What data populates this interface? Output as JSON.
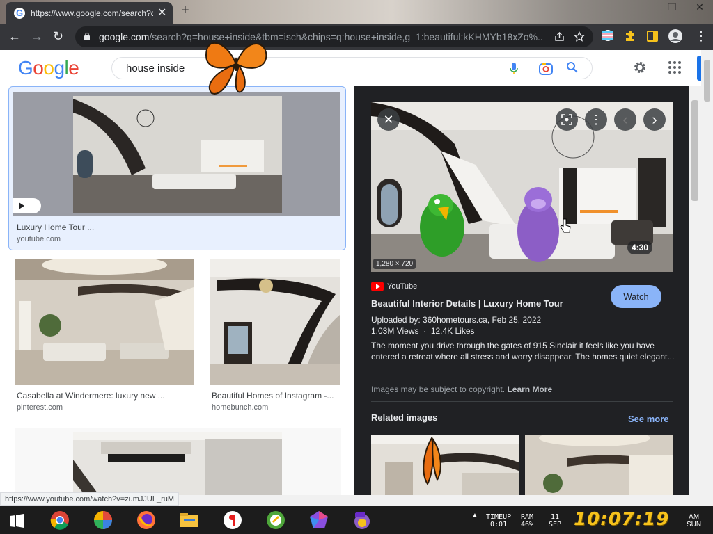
{
  "browser": {
    "tab_title": "https://www.google.com/search?q=house+inside",
    "tab_close": "✕",
    "new_tab": "+",
    "win_min": "—",
    "win_max": "❐",
    "win_close": "✕",
    "url_domain": "google.com",
    "url_rest": "/search?q=house+inside&tbm=isch&chips=q:house+inside,g_1:beautiful:kKHMYb18xZo%...",
    "back": "←",
    "forward": "→",
    "reload": "↻",
    "menu": "⋮",
    "status_url": "https://www.youtube.com/watch?v=zumJJUL_ruM"
  },
  "google": {
    "logo_letters": [
      "G",
      "o",
      "o",
      "g",
      "l",
      "e"
    ],
    "logo_colors": [
      "#4285f4",
      "#ea4335",
      "#fbbc05",
      "#4285f4",
      "#34a853",
      "#ea4335"
    ],
    "query": "house inside"
  },
  "results": [
    {
      "title": "Luxury Home Tour ...",
      "source": "youtube.com"
    },
    {
      "title": "Casabella at Windermere: luxury new ...",
      "source": "pinterest.com"
    },
    {
      "title": "Beautiful Homes of Instagram -...",
      "source": "homebunch.com"
    }
  ],
  "preview": {
    "dimensions": "1,280 × 720",
    "duration": "4:30",
    "source_name": "YouTube",
    "title": "Beautiful Interior Details | Luxury Home Tour",
    "watch_label": "Watch",
    "uploaded": "Uploaded by: 360hometours.ca, Feb 25, 2022",
    "views": "1.03M Views",
    "likes": "12.4K Likes",
    "stats_sep": "·",
    "description": "The moment you drive through the gates of 915 Sinclair it feels like you have entered a retreat where all stress and worry disappear. The homes quiet elegant...",
    "copyright_text": "Images may be subject to copyright.",
    "learn_more": "Learn More",
    "related_heading": "Related images",
    "see_more": "See more",
    "close": "✕",
    "more": "⋮",
    "prev": "‹",
    "next": "›"
  },
  "taskbar": {
    "timeup_label": "TIMEUP",
    "timeup_value": "0:01",
    "ram_label": "RAM",
    "ram_value": "46%",
    "date_day": "11",
    "date_month": "SEP",
    "clock": "10:07:19",
    "ampm": "AM",
    "weekday": "SUN",
    "tray_arrow": "▲"
  }
}
